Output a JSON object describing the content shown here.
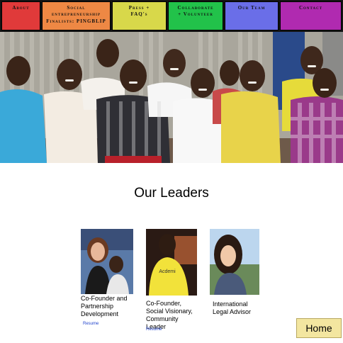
{
  "nav": {
    "items": [
      {
        "label": "About",
        "color": "#e03a3a"
      },
      {
        "label": "Social\nentrepreneurship\nFinalists: PINGBLIP",
        "color": "#ee8844"
      },
      {
        "label": "Press +\nFAQ's",
        "color": "#d8d84a"
      },
      {
        "label": "Collaborate\n+ Volunteer",
        "color": "#22c24a"
      },
      {
        "label": "Our Team",
        "color": "#6a6ee8"
      },
      {
        "label": "Contact",
        "color": "#b02ab0"
      }
    ]
  },
  "section": {
    "title": "Our Leaders"
  },
  "leaders": [
    {
      "role": "Co-Founder and Partnership Development",
      "resume": "Resume"
    },
    {
      "role": "Co-Founder, Social Visionary, Community Leader",
      "resume": "Resume"
    },
    {
      "role": "International Legal Advisor",
      "resume": ""
    }
  ],
  "home_button": "Home"
}
